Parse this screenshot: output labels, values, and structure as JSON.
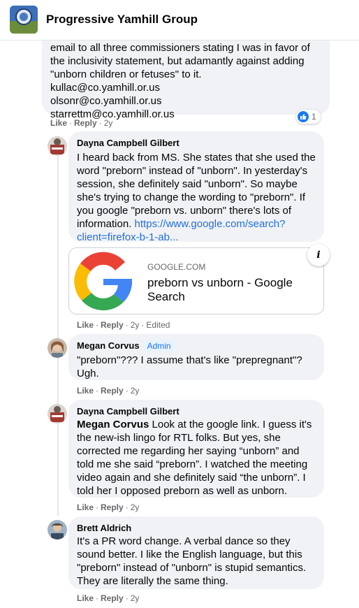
{
  "group": {
    "name": "Progressive Yamhill Group"
  },
  "comments": [
    {
      "text_lines": "email to all three commissioners stating I was in favor of\nthe inclusivity statement, but adamantly against adding\n\"unborn children or fetuses\" to it.\nkullac@co.yamhill.or.us\nolsonr@co.yamhill.or.us\nstarrettm@co.yamhill.or.us",
      "reaction_count": "1",
      "actions": {
        "like": "Like",
        "reply": "Reply",
        "time": "2y"
      }
    },
    {
      "author": "Dayna Campbell Gilbert",
      "text": "I heard back from MS. She states that she used the word \"preborn\" instead of \"unborn\". In yesterday's session, she definitely said \"unborn\". So maybe she's trying to change the wording to \"preborn\". If you google \"preborn vs. unborn\" there's lots of information. ",
      "link_text": "https://www.google.com/search?client=firefox-b-1-ab...",
      "card": {
        "domain": "GOOGLE.COM",
        "title": "preborn vs unborn - Google Search",
        "info_icon": "i"
      },
      "actions": {
        "like": "Like",
        "reply": "Reply",
        "time": "2y",
        "edited": "Edited"
      }
    },
    {
      "author": "Megan Corvus",
      "badge": "Admin",
      "text": "\"preborn\"??? I assume that's like \"prepregnant\"?\nUgh.",
      "actions": {
        "like": "Like",
        "reply": "Reply",
        "time": "2y"
      }
    },
    {
      "author": "Dayna Campbell Gilbert",
      "mention": "Megan Corvus",
      "text": " Look at the google link. I guess it's the new-ish lingo for RTL folks. But yes, she corrected me regarding her saying “unborn” and told me she said “preborn”. I watched the meeting video again and she definitely said “the unborn”. I told her I opposed preborn as well as unborn.",
      "actions": {
        "like": "Like",
        "reply": "Reply",
        "time": "2y"
      }
    },
    {
      "author": "Brett Aldrich",
      "text": "It's a PR word change. A verbal dance so they sound better. I like the English language, but this \"preborn\" instead of \"unborn\" is stupid semantics. They are literally the same thing.",
      "actions": {
        "like": "Like",
        "reply": "Reply",
        "time": "2y"
      }
    }
  ],
  "colors": {
    "bubble": "#f0f2f5",
    "link": "#216fdb",
    "meta": "#65676b",
    "like_blue": "#1877f2"
  }
}
